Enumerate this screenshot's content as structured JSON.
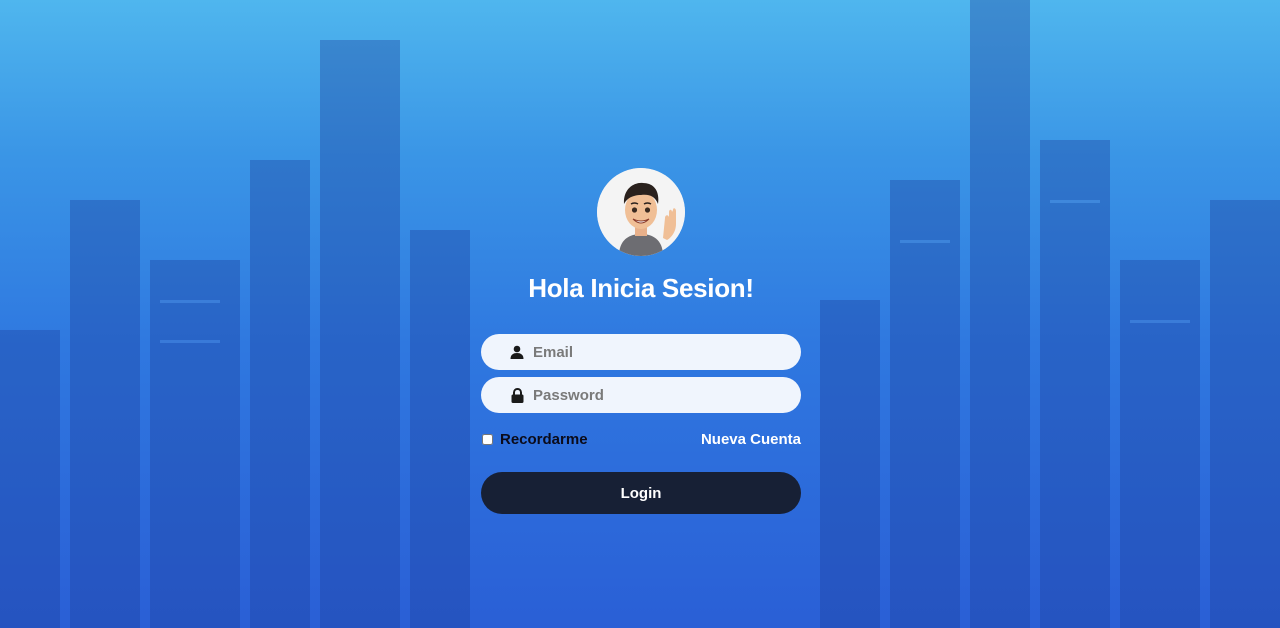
{
  "login": {
    "title": "Hola Inicia Sesion!",
    "email_placeholder": "Email",
    "password_placeholder": "Password",
    "remember_label": "Recordarme",
    "new_account_label": "Nueva Cuenta",
    "login_button_label": "Login"
  },
  "icons": {
    "email": "user-icon",
    "password": "lock-icon",
    "avatar": "waving-boy-avatar"
  },
  "colors": {
    "background_top": "#4fb6ee",
    "background_bottom": "#2a5fd6",
    "button": "#14161e",
    "field": "#ffffff"
  }
}
